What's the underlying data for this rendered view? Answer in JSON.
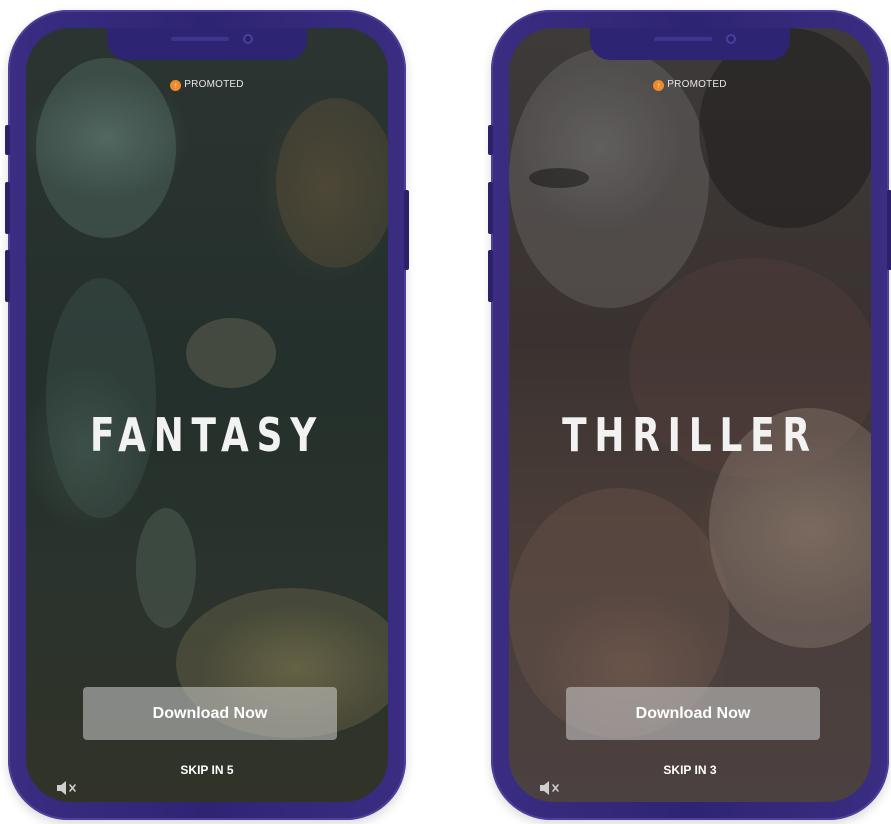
{
  "screens": [
    {
      "promoted_label": "PROMOTED",
      "genre": "FANTASY",
      "download_label": "Download Now",
      "skip_label": "SKIP IN 5",
      "promoted_icon": "arrow-up-circle-icon",
      "mute_icon": "muted-speaker-icon"
    },
    {
      "promoted_label": "PROMOTED",
      "genre": "THRILLER",
      "download_label": "Download Now",
      "skip_label": "SKIP IN 3",
      "promoted_icon": "arrow-up-circle-icon",
      "mute_icon": "muted-speaker-icon"
    }
  ],
  "colors": {
    "phone_frame": "#2e2474",
    "promoted_badge": "#f08a2a",
    "button_overlay": "#cdcdcd"
  }
}
